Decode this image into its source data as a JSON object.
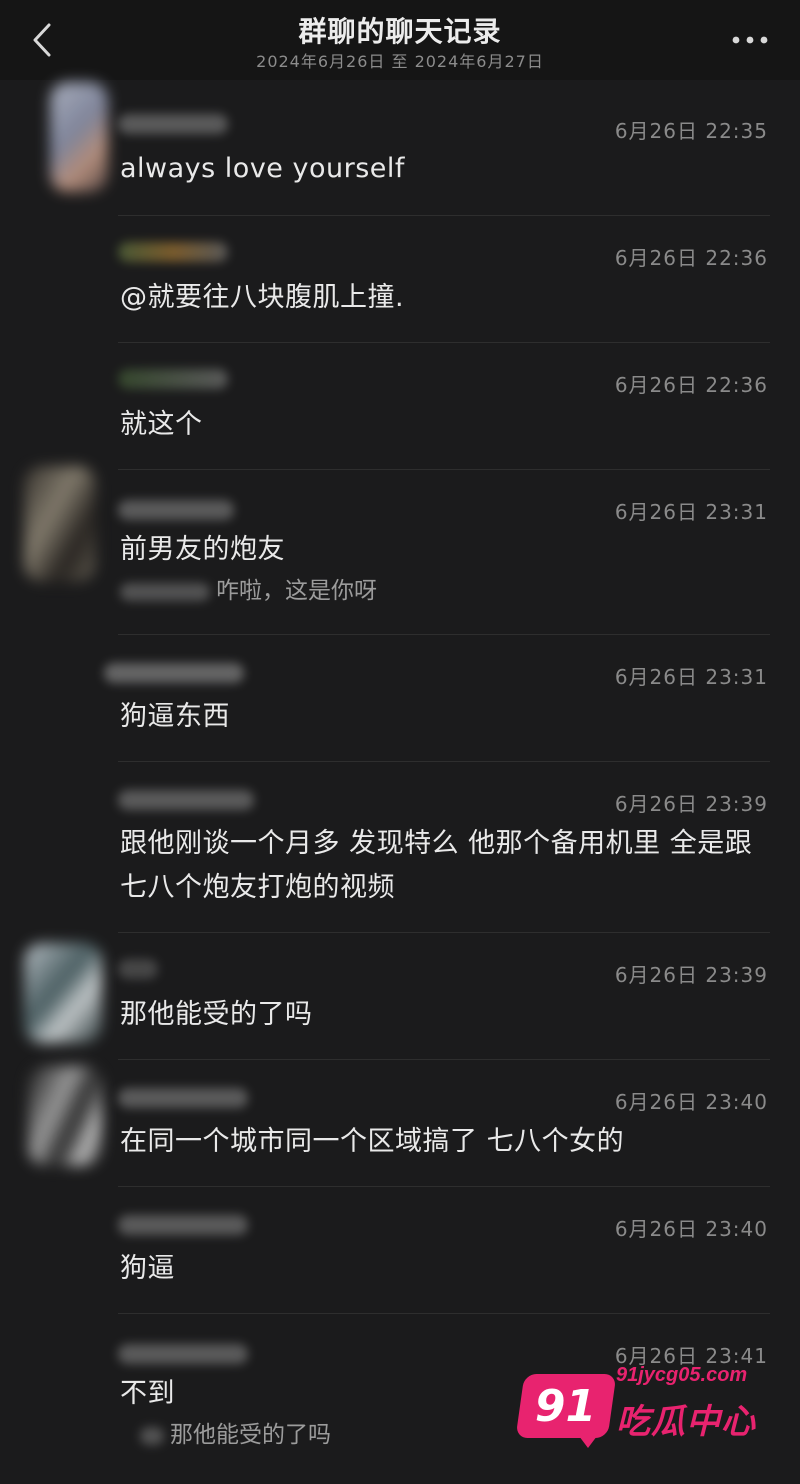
{
  "header": {
    "title": "群聊的聊天记录",
    "date_range": "2024年6月26日 至 2024年6月27日",
    "back_icon": "chevron-left-icon",
    "more_icon": "more-dots-icon"
  },
  "messages": [
    {
      "time": "6月26日 22:35",
      "text": "always love yourself"
    },
    {
      "time": "6月26日 22:36",
      "text": "@就要往八块腹肌上撞."
    },
    {
      "time": "6月26日 22:36",
      "text": "就这个"
    },
    {
      "time": "6月26日 23:31",
      "text": "前男友的炮友",
      "quote": "咋啦，这是你呀"
    },
    {
      "time": "6月26日 23:31",
      "text": "狗逼东西"
    },
    {
      "time": "6月26日 23:39",
      "text": "跟他刚谈一个月多 发现特么 他那个备用机里 全是跟七八个炮友打炮的视频"
    },
    {
      "time": "6月26日 23:39",
      "text": "那他能受的了吗"
    },
    {
      "time": "6月26日 23:40",
      "text": "在同一个城市同一个区域搞了 七八个女的"
    },
    {
      "time": "6月26日 23:40",
      "text": "狗逼"
    },
    {
      "time": "6月26日 23:41",
      "text": "不到",
      "quote": "那他能受的了吗"
    }
  ],
  "watermark": {
    "badge": "91",
    "url": "91jycg05.com",
    "name": "吃瓜中心",
    "color": "#e8236f"
  }
}
